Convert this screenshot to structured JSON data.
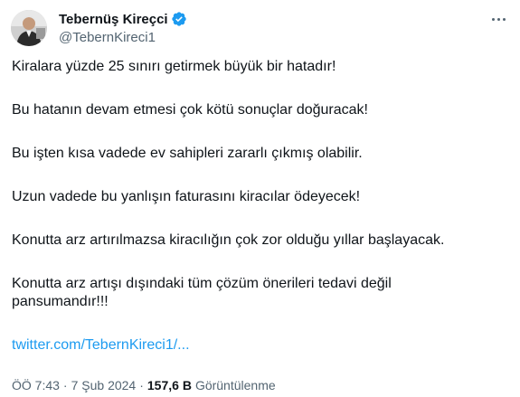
{
  "author": {
    "display_name": "Tebernüş Kireçci",
    "handle": "@TebernKireci1",
    "verified": true,
    "avatar_icon": "profile-photo"
  },
  "tweet": {
    "paragraphs": [
      "Kiralara yüzde 25 sınırı getirmek büyük bir hatadır!",
      "Bu hatanın devam etmesi çok kötü sonuçlar doğuracak!",
      "Bu işten kısa vadede ev sahipleri zararlı çıkmış olabilir.",
      "Uzun vadede bu yanlışın faturasını kiracılar ödeyecek!",
      "Konutta arz artırılmazsa kiracılığın çok zor olduğu yıllar başlayacak.",
      "Konutta arz artışı dışındaki tüm çözüm önerileri tedavi değil pansumandır!!!"
    ],
    "link": "twitter.com/TebernKireci1/..."
  },
  "meta": {
    "time": "ÖÖ 7:43",
    "separator": "·",
    "date": "7 Şub 2024",
    "views_count": "157,6 B",
    "views_label": "Görüntülenme"
  },
  "colors": {
    "link": "#1d9bf0",
    "verified": "#1d9bf0",
    "secondary_text": "#536471",
    "primary_text": "#0f1419"
  }
}
